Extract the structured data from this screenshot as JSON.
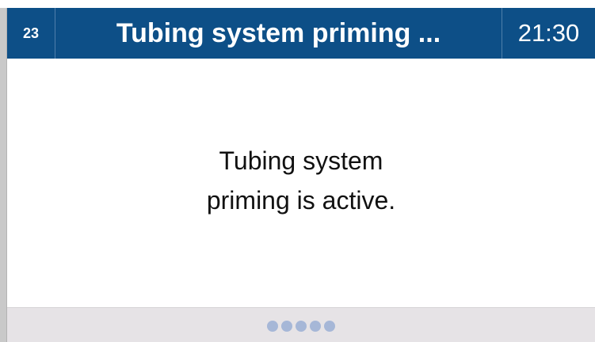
{
  "header": {
    "step_number": "23",
    "title": "Tubing system priming ...",
    "time": "21:30"
  },
  "message": {
    "line1": "Tubing system",
    "line2": "priming is active."
  },
  "footer": {
    "progress_indicator": {
      "dot_count": 5,
      "color": "#a6b7d7"
    }
  },
  "colors": {
    "header_background": "#0d4f87",
    "footer_background": "#e6e3e6",
    "content_background": "#ffffff"
  }
}
